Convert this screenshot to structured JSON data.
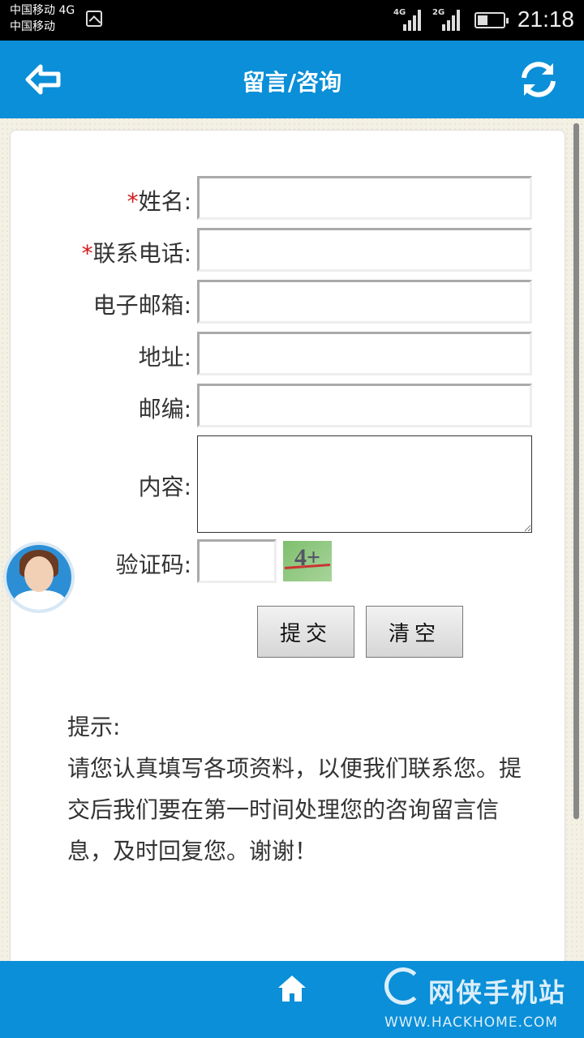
{
  "status_bar": {
    "carrier1": "中国移动 4G",
    "carrier2": "中国移动",
    "net1": "4G",
    "net2": "2G",
    "time": "21:18"
  },
  "header": {
    "title": "留言/咨询",
    "back_icon": "back-arrow-icon",
    "refresh_icon": "refresh-icon"
  },
  "form": {
    "required_mark": "*",
    "name_label": "姓名:",
    "phone_label": "联系电话:",
    "email_label": "电子邮箱:",
    "address_label": "地址:",
    "zip_label": "邮编:",
    "content_label": "内容:",
    "captcha_label": "验证码:",
    "captcha_image_text": "4+",
    "submit_label": "提交",
    "clear_label": "清空"
  },
  "hint": {
    "title": "提示:",
    "body": "请您认真填写各项资料，以便我们联系您。提交后我们要在第一时间处理您的咨询留言信息，及时回复您。谢谢！"
  },
  "bottom_bar": {
    "home_icon": "home-icon",
    "watermark_text": "网侠手机站",
    "watermark_url": "WWW.HACKHOME.COM"
  },
  "colors": {
    "primary": "#0a8fd8",
    "required": "#d41a1a"
  }
}
